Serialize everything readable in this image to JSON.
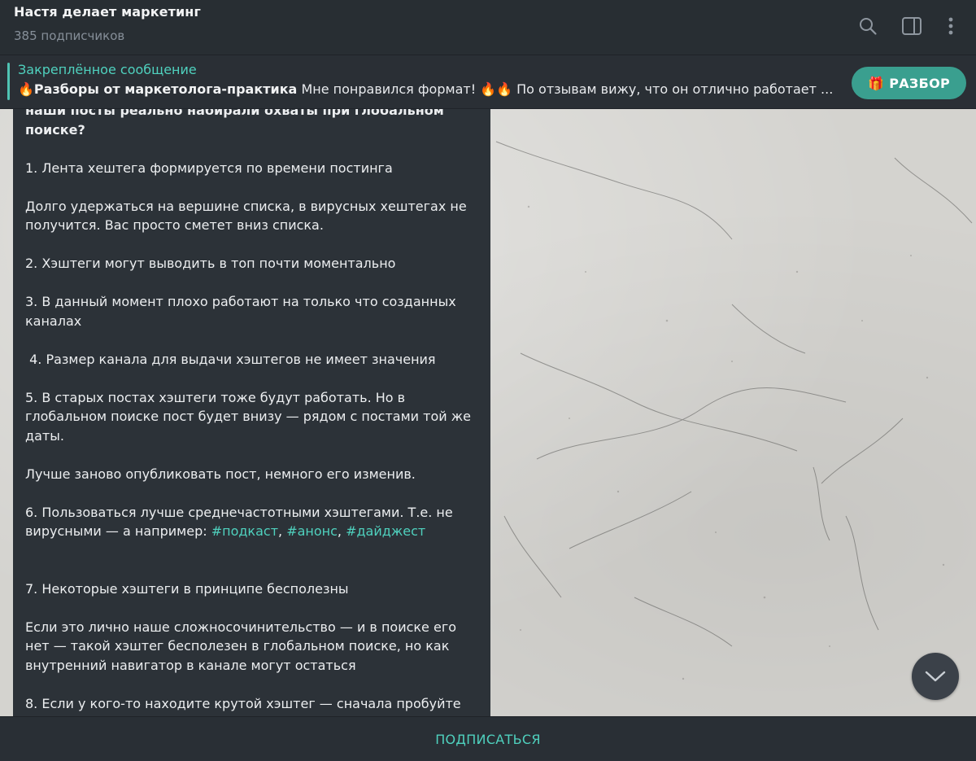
{
  "header": {
    "title": "Настя делает маркетинг",
    "subtitle": "385 подписчиков",
    "icons": [
      "search-icon",
      "sidebar-toggle-icon",
      "more-vertical-icon"
    ]
  },
  "pinned": {
    "label": "Закреплённое сообщение",
    "emoji_lead": "🔥",
    "bold_text": "Разборы от маркетолога-практика",
    "rest_text": "  Мне понравился формат! 🔥🔥 По отзывам вижу, что он отлично работает ...",
    "button_icon": "🎁",
    "button_label": "РАЗБОР"
  },
  "message": {
    "head_line1": "наши посты реально набирали охваты при глобальном",
    "head_line2": "поиске?",
    "p1": "1. Лента хештега формируется по времени постинга",
    "p2": "Долго удержаться на вершине списка, в вирусных хештегах не получится. Вас просто сметет вниз списка.",
    "p3": "2. Хэштеги могут выводить в топ почти моментально",
    "p4": "3. В данный момент плохо работают на только что созданных каналах",
    "p5": " 4. Размер канала для выдачи хэштегов не имеет значения",
    "p6": "5. В старых постах хэштеги тоже будут работать. Но в глобальном поиске пост будет внизу — рядом с постами той же даты.",
    "p7": "Лучше заново опубликовать пост, немного его изменив.",
    "p8_text": "6. Пользоваться лучше среднечастотными хэштегами. Т.е. не вирусными — а например: ",
    "tags": [
      "#подкаст",
      "#анонс",
      "#дайджест"
    ],
    "tag_sep": ", ",
    "p9": "7. Некоторые хэштеги в принципе бесполезны",
    "p10": "Если это лично наше сложносочинительство — и в поиске его нет — такой хэштег бесполезен в глобальном поиске, но как внутренний навигатор в канале могут остаться",
    "p11": "8. Если у кого-то находите крутой хэштег — сначала пробуйте"
  },
  "bottom": {
    "subscribe_label": "ПОДПИСАТЬСЯ"
  },
  "colors": {
    "accent": "#4fd1be",
    "button_bg": "#3a9f8f",
    "panel": "#282e33",
    "bubble": "#2c3238"
  }
}
